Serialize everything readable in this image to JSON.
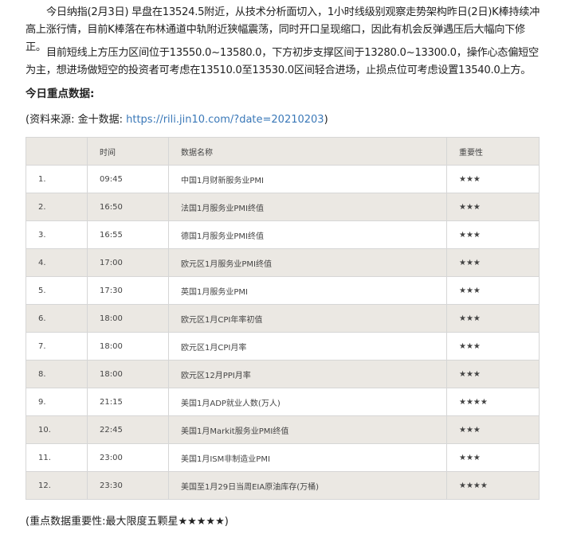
{
  "intro": {
    "paragraph1": "今日纳指(2月3日) 早盘在13524.5附近，从技术分析面切入，1小时线级别观察走势架构昨日(2日)K棒持续冲高上涨行情，目前K棒落在布林通道中轨附近狭幅震荡，同时开口呈现缩口，因此有机会反弹遇压后大幅向下修正。",
    "paragraph2": "目前短线上方压力区间位于13550.0~13580.0，下方初步支撑区间于13280.0~13300.0，操作心态偏短空为主，想进场做短空的投资者可考虑在13510.0至13530.0区间轻合进场，止损点位可考虑设置13540.0上方。"
  },
  "section": {
    "title": "今日重点数据:"
  },
  "source": {
    "prefix": "(资料来源: 金十数据: ",
    "link": "https://rili.jin10.com/?date=20210203",
    "suffix": ")"
  },
  "table": {
    "headers": [
      "",
      "时间",
      "数据名称",
      "重要性"
    ],
    "rows": [
      [
        "1.",
        "09:45",
        "中国1月财新服务业PMI",
        "★★★"
      ],
      [
        "2.",
        "16:50",
        "法国1月服务业PMI终值",
        "★★★"
      ],
      [
        "3.",
        "16:55",
        "德国1月服务业PMI终值",
        "★★★"
      ],
      [
        "4.",
        "17:00",
        "欧元区1月服务业PMI终值",
        "★★★"
      ],
      [
        "5.",
        "17:30",
        "英国1月服务业PMI",
        "★★★"
      ],
      [
        "6.",
        "18:00",
        "欧元区1月CPI年率初值",
        "★★★"
      ],
      [
        "7.",
        "18:00",
        "欧元区1月CPI月率",
        "★★★"
      ],
      [
        "8.",
        "18:00",
        "欧元区12月PPI月率",
        "★★★"
      ],
      [
        "9.",
        "21:15",
        "美国1月ADP就业人数(万人)",
        "★★★★"
      ],
      [
        "10.",
        "22:45",
        "美国1月Markit服务业PMI终值",
        "★★★"
      ],
      [
        "11.",
        "23:00",
        "美国1月ISM非制造业PMI",
        "★★★"
      ],
      [
        "12.",
        "23:30",
        "美国至1月29日当周EIA原油库存(万桶)",
        "★★★★"
      ]
    ]
  },
  "footer": {
    "note": "(重点数据重要性:最大限度五颗星★★★★★)"
  }
}
